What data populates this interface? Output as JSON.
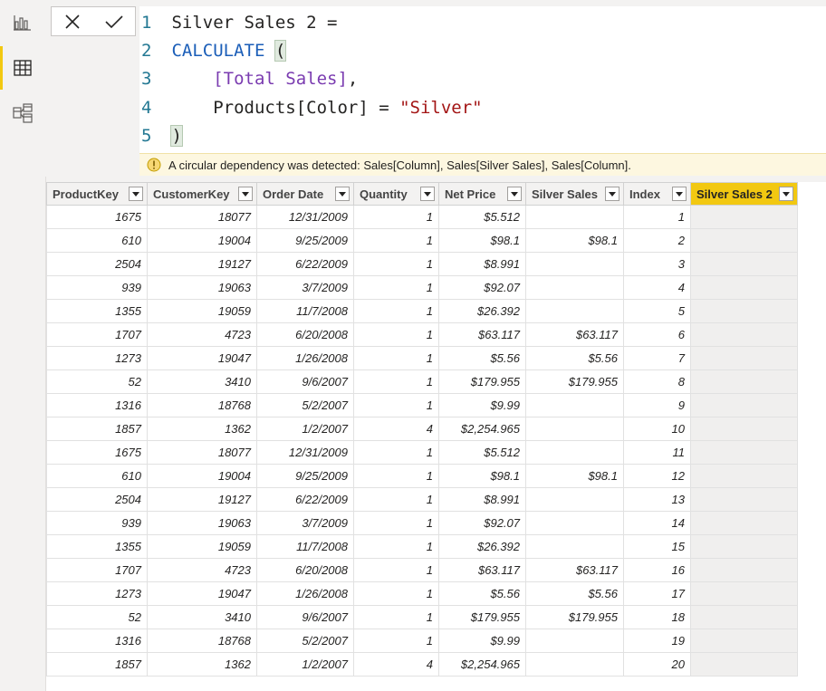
{
  "rail": {
    "items": [
      {
        "name": "report-view",
        "icon": "bar-chart-icon",
        "active": false
      },
      {
        "name": "data-view",
        "icon": "table-icon",
        "active": true
      },
      {
        "name": "model-view",
        "icon": "model-icon",
        "active": false
      }
    ]
  },
  "formula_bar": {
    "cancel_icon": "close-icon",
    "commit_icon": "checkmark-icon",
    "lines": [
      {
        "num": "1",
        "text": "Silver Sales 2 ="
      },
      {
        "num": "2",
        "fn": "CALCULATE",
        "paren": "("
      },
      {
        "num": "3",
        "ref": "[Total Sales]",
        "tail": ","
      },
      {
        "num": "4",
        "pre": "Products[Color] = ",
        "str": "\"Silver\""
      },
      {
        "num": "5",
        "paren": ")"
      }
    ],
    "warning": "A circular dependency was detected: Sales[Column], Sales[Silver Sales], Sales[Column]."
  },
  "table": {
    "columns": [
      "ProductKey",
      "CustomerKey",
      "Order Date",
      "Quantity",
      "Net Price",
      "Silver Sales",
      "Index",
      "Silver Sales 2"
    ],
    "highlight_column": 7,
    "highlight_color": "#f2c811",
    "rows": [
      [
        "1675",
        "18077",
        "12/31/2009",
        "1",
        "$5.512",
        "",
        "1",
        ""
      ],
      [
        "610",
        "19004",
        "9/25/2009",
        "1",
        "$98.1",
        "$98.1",
        "2",
        ""
      ],
      [
        "2504",
        "19127",
        "6/22/2009",
        "1",
        "$8.991",
        "",
        "3",
        ""
      ],
      [
        "939",
        "19063",
        "3/7/2009",
        "1",
        "$92.07",
        "",
        "4",
        ""
      ],
      [
        "1355",
        "19059",
        "11/7/2008",
        "1",
        "$26.392",
        "",
        "5",
        ""
      ],
      [
        "1707",
        "4723",
        "6/20/2008",
        "1",
        "$63.117",
        "$63.117",
        "6",
        ""
      ],
      [
        "1273",
        "19047",
        "1/26/2008",
        "1",
        "$5.56",
        "$5.56",
        "7",
        ""
      ],
      [
        "52",
        "3410",
        "9/6/2007",
        "1",
        "$179.955",
        "$179.955",
        "8",
        ""
      ],
      [
        "1316",
        "18768",
        "5/2/2007",
        "1",
        "$9.99",
        "",
        "9",
        ""
      ],
      [
        "1857",
        "1362",
        "1/2/2007",
        "4",
        "$2,254.965",
        "",
        "10",
        ""
      ],
      [
        "1675",
        "18077",
        "12/31/2009",
        "1",
        "$5.512",
        "",
        "11",
        ""
      ],
      [
        "610",
        "19004",
        "9/25/2009",
        "1",
        "$98.1",
        "$98.1",
        "12",
        ""
      ],
      [
        "2504",
        "19127",
        "6/22/2009",
        "1",
        "$8.991",
        "",
        "13",
        ""
      ],
      [
        "939",
        "19063",
        "3/7/2009",
        "1",
        "$92.07",
        "",
        "14",
        ""
      ],
      [
        "1355",
        "19059",
        "11/7/2008",
        "1",
        "$26.392",
        "",
        "15",
        ""
      ],
      [
        "1707",
        "4723",
        "6/20/2008",
        "1",
        "$63.117",
        "$63.117",
        "16",
        ""
      ],
      [
        "1273",
        "19047",
        "1/26/2008",
        "1",
        "$5.56",
        "$5.56",
        "17",
        ""
      ],
      [
        "52",
        "3410",
        "9/6/2007",
        "1",
        "$179.955",
        "$179.955",
        "18",
        ""
      ],
      [
        "1316",
        "18768",
        "5/2/2007",
        "1",
        "$9.99",
        "",
        "19",
        ""
      ],
      [
        "1857",
        "1362",
        "1/2/2007",
        "4",
        "$2,254.965",
        "",
        "20",
        ""
      ]
    ]
  }
}
